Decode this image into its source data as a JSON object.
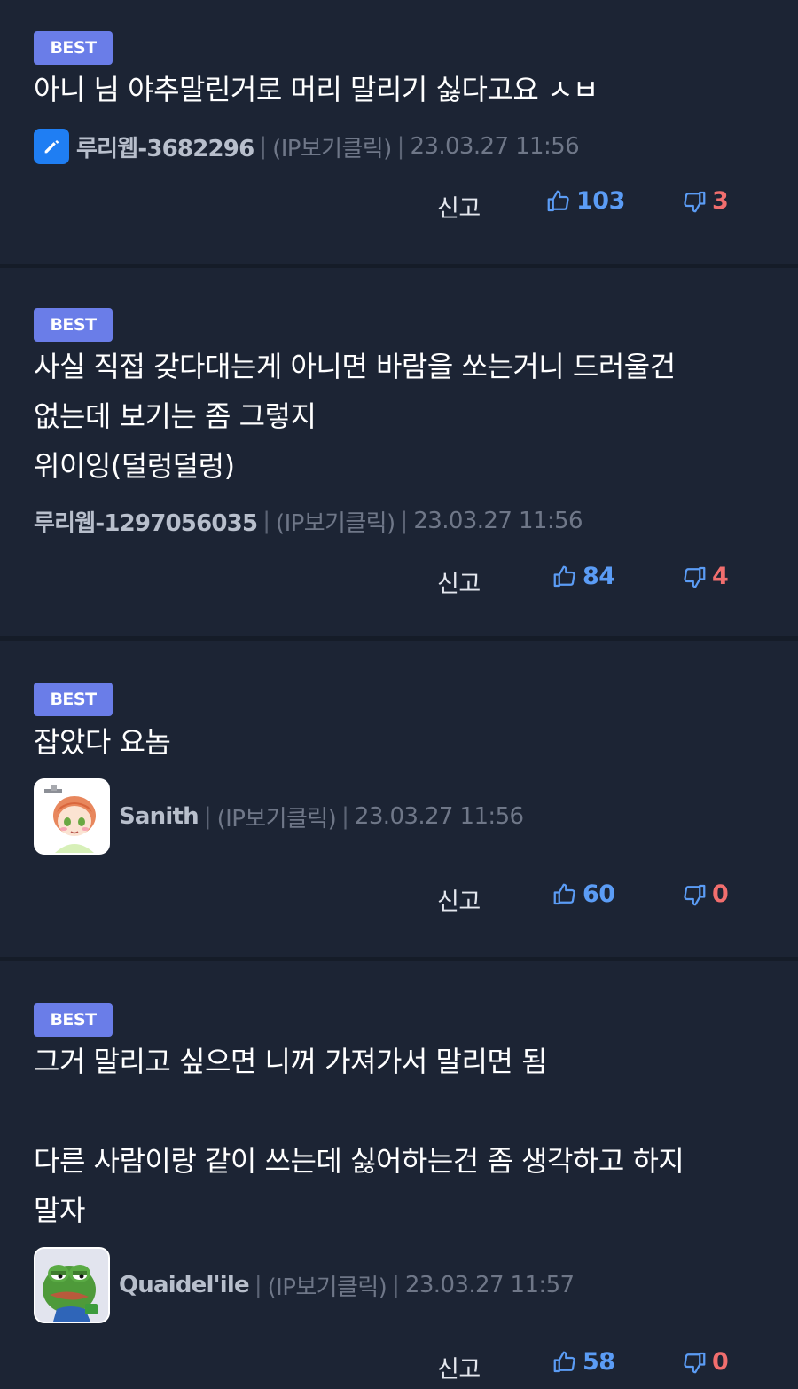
{
  "comments": [
    {
      "badge": "BEST",
      "lines": [
        "아니 님 야추말린거로 머리 말리기 싫다고요 ㅅㅂ"
      ],
      "avatar": "pencil-icon",
      "username": "루리웹-3682296",
      "ip_label": "(IP보기클릭)",
      "date": "23.03.27 11:56",
      "report_label": "신고",
      "likes": "103",
      "dislikes": "3"
    },
    {
      "badge": "BEST",
      "lines": [
        "사실 직접 갖다대는게 아니면 바람을 쏘는거니 드러울건",
        "없는데 보기는 좀 그렇지",
        "위이잉(덜렁덜렁)"
      ],
      "avatar": "",
      "username": "루리웹-1297056035",
      "ip_label": "(IP보기클릭)",
      "date": "23.03.27 11:56",
      "report_label": "신고",
      "likes": "84",
      "dislikes": "4"
    },
    {
      "badge": "BEST",
      "lines": [
        "잡았다 요놈"
      ],
      "avatar": "anime-girl-avatar",
      "username": "Sanith",
      "ip_label": "(IP보기클릭)",
      "date": "23.03.27 11:56",
      "report_label": "신고",
      "likes": "60",
      "dislikes": "0"
    },
    {
      "badge": "BEST",
      "lines": [
        "그거 말리고 싶으면 니꺼 가져가서 말리면 됨",
        "",
        "다른 사람이랑 같이 쓰는데 싫어하는건 좀 생각하고 하지",
        "말자"
      ],
      "avatar": "frog-avatar",
      "username": "Quaidel'ile",
      "ip_label": "(IP보기클릭)",
      "date": "23.03.27 11:57",
      "report_label": "신고",
      "likes": "58",
      "dislikes": "0"
    }
  ],
  "colors": {
    "background": "#1c2434",
    "badge": "#6a7de8",
    "like": "#5b9cf5",
    "dislike": "#f16e6e"
  }
}
